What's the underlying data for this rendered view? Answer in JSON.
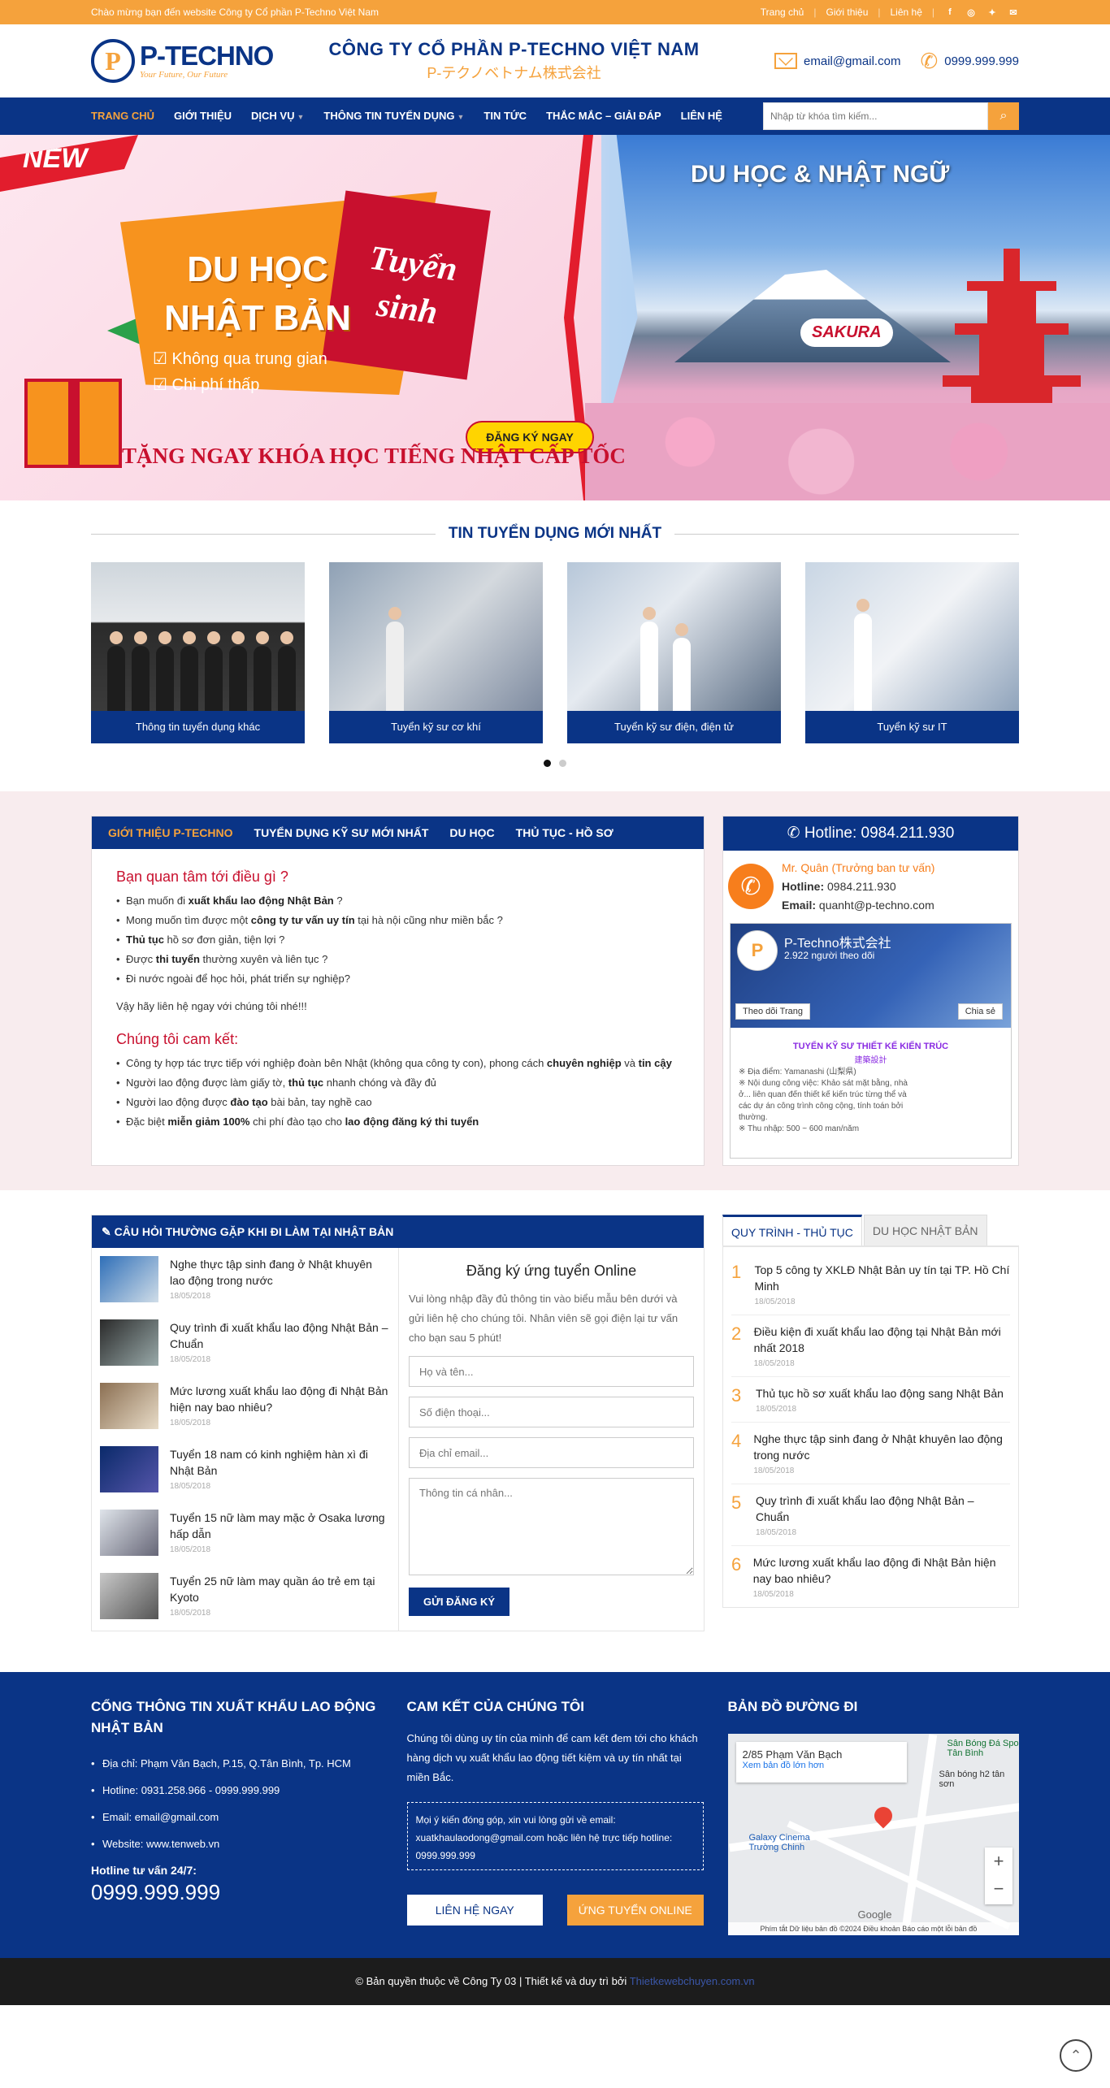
{
  "topbar": {
    "welcome": "Chào mừng bạn đến website Công ty Cổ phần P-Techno Việt Nam",
    "links": [
      "Trang chủ",
      "Giới thiệu",
      "Liên hệ"
    ],
    "social_icons": [
      "facebook-icon",
      "instagram-icon",
      "twitter-icon",
      "mail-icon"
    ]
  },
  "header": {
    "logo_letter": "P",
    "logo_name": "P-TECHNO",
    "logo_slogan": "Your Future, Our Future",
    "company_name": "CÔNG TY CỔ PHẦN P-TECHNO VIỆT NAM",
    "company_name_jp": "P-テクノベトナム株式会社",
    "email": "email@gmail.com",
    "phone": "0999.999.999"
  },
  "nav": {
    "items": [
      "Trang chủ",
      "Giới thiệu",
      "Dịch vụ",
      "Thông tin tuyển dụng",
      "Tin tức",
      "Thắc mắc – Giải đáp",
      "Liên hệ"
    ],
    "search_placeholder": "Nhập từ khóa tìm kiếm...",
    "active_color": "#f5a23c"
  },
  "banner": {
    "new_tag": "NEW",
    "title": "DU HỌC NHẬT BẢN",
    "stamp": "Tuyển sinh",
    "bullets": [
      "Không qua trung gian",
      "Chi phí thấp"
    ],
    "cta": "ĐĂNG KÝ NGAY",
    "promo": "TẶNG NGAY KHÓA HỌC TIẾNG NHẬT CẤP TỐC",
    "right_title": "DU HỌC & NHẬT NGỮ",
    "brand": "SAKURA"
  },
  "jobs": {
    "title": "TIN TUYỂN DỤNG MỚI NHẤT",
    "items": [
      "Thông tin tuyển dụng khác",
      "Tuyển kỹ sư cơ khí",
      "Tuyển kỹ sư điện, điện tử",
      "Tuyển kỹ sư IT"
    ]
  },
  "intro": {
    "tabs": [
      "Giới thiệu P-Techno",
      "Tuyển dụng kỹ sư mới nhất",
      "Du học",
      "Thủ tục - Hồ sơ"
    ],
    "h1": "Bạn quan tâm tới điều gì ?",
    "list1": [
      [
        "Bạn muốn đi ",
        "xuất khẩu lao động Nhật Bản",
        " ?"
      ],
      [
        "Mong muốn tìm được một ",
        "công ty tư vấn uy tín",
        " tại hà nội cũng như miền bắc ?"
      ],
      [
        "",
        "Thủ tục",
        " hồ sơ đơn giản, tiện lợi ?"
      ],
      [
        "Được ",
        "thi tuyển",
        " thường xuyên và liên tục ?"
      ],
      [
        "Đi nước ngoài để học hỏi, phát triển sự nghiệp?",
        "",
        ""
      ]
    ],
    "p": "Vậy hãy liên hệ ngay với chúng tôi nhé!!!",
    "h2": "Chúng tôi cam kết:",
    "list2": [
      [
        "Công ty hợp tác trực tiếp với nghiệp đoàn bên Nhật (không qua công ty con), phong cách ",
        "chuyên nghiệp",
        " và ",
        "tin cậy",
        ""
      ],
      [
        "Người lao động được làm giấy tờ, ",
        "thủ tục",
        " nhanh chóng và đầy đủ",
        "",
        ""
      ],
      [
        "Người lao động được ",
        "đào tạo",
        " bài bản, tay nghề cao",
        "",
        ""
      ],
      [
        "Đặc biệt ",
        "miễn giảm 100%",
        " chi phí đào tạo cho ",
        "lao động đăng ký thi tuyển",
        ""
      ]
    ]
  },
  "hotline": {
    "title": "Hotline: 0984.211.930",
    "name": "Mr. Quân (Trưởng ban tư vấn)",
    "hotline_label": "Hotline:",
    "hotline_value": "0984.211.930",
    "email_label": "Email:",
    "email_value": "quanht@p-techno.com",
    "fb_name": "P-Techno株式会社",
    "fb_followers": "2.922 người theo dõi",
    "fb_follow_btn": "Theo dõi Trang",
    "fb_share_btn": "Chia sẻ",
    "fb_post_title": "TUYỂN KỸ SƯ THIẾT KẾ KIẾN TRÚC",
    "fb_post_sub": "建築設計",
    "fb_post_lines": [
      "※ Địa điểm: Yamanashi (山梨県)",
      "※ Nội dung công việc: Khảo sát mặt bằng, nhà ở... liên quan đến thiết kế kiến trúc từng thể và các dự án công trình công cộng, tính toán bởi thường.",
      "※ Thu nhập: 500 ~ 600 man/năm"
    ]
  },
  "faq": {
    "title": "CÂU HỎI THƯỜNG GẶP KHI ĐI LÀM TẠI NHẬT BẢN",
    "items": [
      {
        "t": "Nghe thực tập sinh đang ở Nhật khuyên lao động trong nước",
        "d": "18/05/2018"
      },
      {
        "t": "Quy trình đi xuất khẩu lao động Nhật Bản – Chuẩn",
        "d": "18/05/2018"
      },
      {
        "t": "Mức lương xuất khẩu lao động đi Nhật Bản hiện nay bao nhiêu?",
        "d": "18/05/2018"
      },
      {
        "t": "Tuyển 18 nam có kinh nghiệm hàn xì đi Nhật Bản",
        "d": "18/05/2018"
      },
      {
        "t": "Tuyển 15 nữ làm may mặc ở Osaka lương hấp dẫn",
        "d": "18/05/2018"
      },
      {
        "t": "Tuyển 25 nữ làm may quần áo trẻ em tại Kyoto",
        "d": "18/05/2018"
      }
    ],
    "form_title": "Đăng ký ứng tuyển Online",
    "form_desc": "Vui lòng nhập đầy đủ thông tin vào biểu mẫu bên dưới và gửi liên hệ cho chúng tôi. Nhân viên sẽ gọi điện lại tư vấn cho bạn sau 5 phút!",
    "ph_name": "Họ và tên...",
    "ph_phone": "Số điện thoại...",
    "ph_email": "Địa chỉ email...",
    "ph_info": "Thông tin cá nhân...",
    "submit": "Gửi đăng ký"
  },
  "process": {
    "tabs": [
      "Quy trình - Thủ tục",
      "Du học Nhật Bản"
    ],
    "items": [
      {
        "n": "1",
        "t": "Top 5 công ty XKLĐ Nhật Bản uy tín tại TP. Hồ Chí Minh",
        "d": "18/05/2018"
      },
      {
        "n": "2",
        "t": "Điều kiện đi xuất khẩu lao động tại Nhật Bản mới nhất 2018",
        "d": "18/05/2018"
      },
      {
        "n": "3",
        "t": "Thủ tục hồ sơ xuất khẩu lao động sang Nhật Bản",
        "d": "18/05/2018"
      },
      {
        "n": "4",
        "t": "Nghe thực tập sinh đang ở Nhật khuyên lao động trong nước",
        "d": "18/05/2018"
      },
      {
        "n": "5",
        "t": "Quy trình đi xuất khẩu lao động Nhật Bản – Chuẩn",
        "d": "18/05/2018"
      },
      {
        "n": "6",
        "t": "Mức lương xuất khẩu lao động đi Nhật Bản hiện nay bao nhiêu?",
        "d": "18/05/2018"
      }
    ]
  },
  "footer": {
    "col1_title": "CỔNG THÔNG TIN XUẤT KHẨU LAO ĐỘNG NHẬT BẢN",
    "col1_items": [
      "Địa chỉ: Phạm Văn Bạch, P.15, Q.Tân Bình, Tp. HCM",
      "Hotline: 0931.258.966 - 0999.999.999",
      "Email: email@gmail.com",
      "Website: www.tenweb.vn"
    ],
    "hotline_label": "Hotline tư vấn 24/7:",
    "hotline_big": "0999.999.999",
    "col2_title": "CAM KẾT CỦA CHÚNG TÔI",
    "col2_text": "Chúng tôi dùng uy tín của mình để cam kết đem tới cho khách hàng dịch vụ xuất khẩu lao động tiết kiệm và uy tín nhất tại miền Bắc.",
    "col2_note": "Mọi ý kiến đóng góp, xin vui lòng gửi về email: xuatkhaulaodong@gmail.com hoặc liên hệ trực tiếp hotline: 0999.999.999",
    "btn_contact": "Liên hệ ngay",
    "btn_apply": "Ứng tuyển online",
    "col3_title": "BẢN ĐỒ ĐƯỜNG ĐI",
    "map_place": "2/85 Phạm Văn Bạch",
    "map_link": "Xem bản đồ lớn hơn",
    "map_poi1": "Sân Bóng Đá Sport Tân Bình",
    "map_poi2": "Sân bóng h2 tân sơn",
    "map_poi3": "Galaxy Cinema Trường Chinh",
    "map_brand": "Google",
    "map_foot": "Phím tắt   Dữ liệu bản đồ ©2024   Điều khoản   Báo cáo một lỗi bản đồ",
    "copyright": "© Bản quyền thuộc về Công Ty 03  |  Thiết kế và duy trì bởi",
    "credit": "Thietkewebchuyen.com.vn"
  }
}
